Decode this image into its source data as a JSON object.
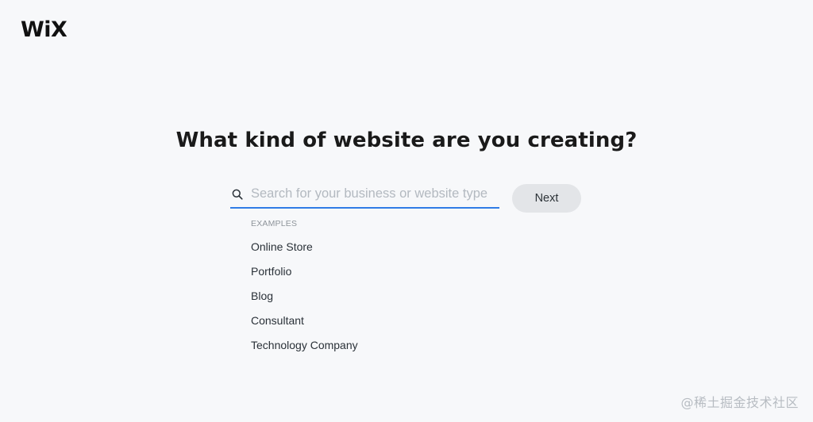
{
  "brand": {
    "logo_text": "WiX"
  },
  "main": {
    "headline": "What kind of website are you creating?"
  },
  "search": {
    "placeholder": "Search for your business or website type",
    "value": "",
    "icon": "search-icon",
    "underline_color": "#2f7ce6"
  },
  "next_button": {
    "label": "Next"
  },
  "examples": {
    "label": "EXAMPLES",
    "items": [
      "Online Store",
      "Portfolio",
      "Blog",
      "Consultant",
      "Technology Company"
    ]
  },
  "watermark": {
    "text": "@稀土掘金技术社区"
  }
}
